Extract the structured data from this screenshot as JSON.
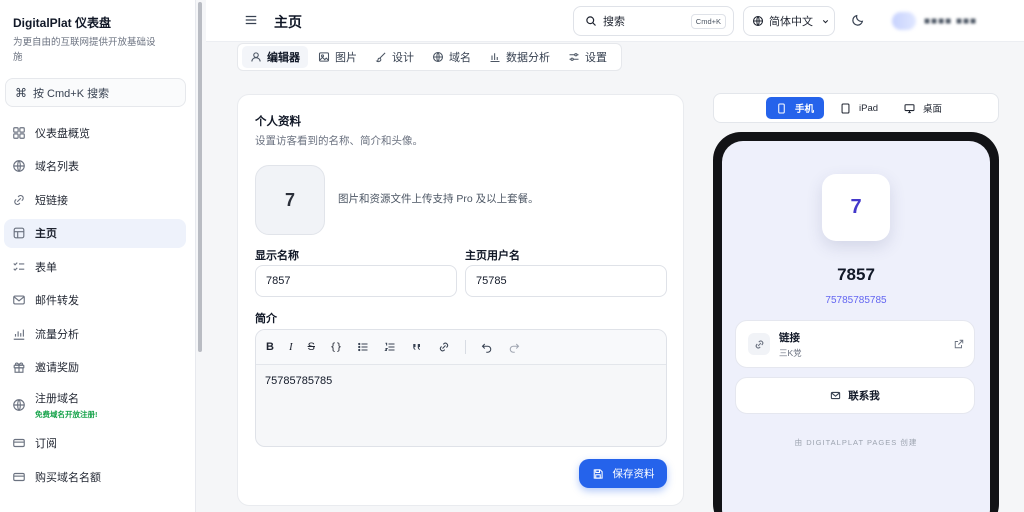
{
  "brand": {
    "title": "DigitalPlat 仪表盘",
    "subtitle": "为更自由的互联网提供开放基础设施"
  },
  "sidebar": {
    "search_label": "按 Cmd+K 搜索",
    "items": [
      {
        "label": "仪表盘概览",
        "icon": "grid-icon"
      },
      {
        "label": "域名列表",
        "icon": "globe-icon"
      },
      {
        "label": "短链接",
        "icon": "link-icon"
      },
      {
        "label": "主页",
        "icon": "home-icon",
        "active": true
      },
      {
        "label": "表单",
        "icon": "list-check-icon"
      },
      {
        "label": "邮件转发",
        "icon": "mail-icon"
      },
      {
        "label": "流量分析",
        "icon": "chart-icon"
      },
      {
        "label": "邀请奖励",
        "icon": "gift-icon"
      },
      {
        "label": "注册域名",
        "icon": "globe-icon",
        "badge": "免费域名开放注册!"
      },
      {
        "label": "订阅",
        "icon": "card-icon"
      },
      {
        "label": "购买域名名额",
        "icon": "card-icon"
      }
    ]
  },
  "header": {
    "title": "主页",
    "search_label": "搜索",
    "search_shortcut": "Cmd+K",
    "language": "简体中文"
  },
  "tabs": [
    {
      "label": "编辑器",
      "icon": "user-icon",
      "active": true
    },
    {
      "label": "图片",
      "icon": "image-icon"
    },
    {
      "label": "设计",
      "icon": "brush-icon"
    },
    {
      "label": "域名",
      "icon": "globe-icon"
    },
    {
      "label": "数据分析",
      "icon": "bar-chart-icon"
    },
    {
      "label": "设置",
      "icon": "sliders-icon"
    }
  ],
  "profile": {
    "title": "个人资料",
    "subtitle": "设置访客看到的名称、简介和头像。",
    "avatar_letter": "7",
    "upload_note": "图片和资源文件上传支持 Pro 及以上套餐。",
    "display_name_label": "显示名称",
    "display_name_value": "7857",
    "username_label": "主页用户名",
    "username_value": "75785",
    "bio_label": "简介",
    "bio_value": "75785785785",
    "save_label": "保存资料"
  },
  "preview": {
    "devices": [
      {
        "label": "手机",
        "icon": "phone-icon",
        "active": true
      },
      {
        "label": "iPad",
        "icon": "tablet-icon"
      },
      {
        "label": "桌面",
        "icon": "monitor-icon"
      }
    ],
    "avatar_letter": "7",
    "name": "7857",
    "handle": "75785785785",
    "link_title": "链接",
    "link_sub": "三K党",
    "contact_label": "联系我",
    "footer": "由 DIGITALPLAT PAGES 创建"
  },
  "colors": {
    "accent": "#2563eb",
    "preview_bg": "#eef0fb",
    "brand_text": "#4338ca"
  }
}
